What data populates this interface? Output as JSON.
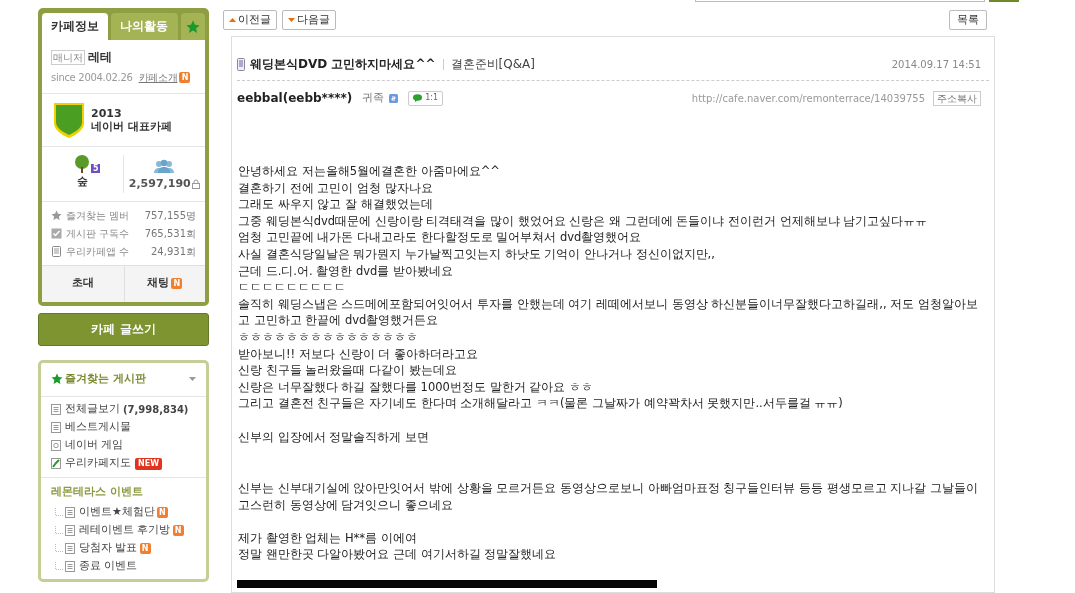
{
  "sidebar": {
    "tabs": [
      {
        "label": "카페정보",
        "selected": true
      },
      {
        "label": "나의활동",
        "selected": false
      }
    ],
    "manager": {
      "role": "매니저",
      "name": "레테"
    },
    "since": "since 2004.02.26",
    "intro_link": {
      "label": "카페소개",
      "badge": "N"
    },
    "award": {
      "year": "2013",
      "title": "네이버 대표카페"
    },
    "stats": {
      "level_badge": "5",
      "rank": "숲",
      "members": "2,597,190"
    },
    "counts": [
      {
        "kind": "star",
        "label": "즐겨찾는 멤버",
        "value": "757,155명"
      },
      {
        "kind": "check",
        "label": "게시판 구독수",
        "value": "765,531회"
      },
      {
        "kind": "phone",
        "label": "우리카페앱 수",
        "value": "24,931회"
      }
    ],
    "actions": [
      {
        "label": "초대"
      },
      {
        "label": "채팅",
        "badge": "N"
      }
    ],
    "write_button": "카페 글쓰기",
    "favorites_title": "즐겨찾는 게시판",
    "boards": [
      {
        "kind": "list",
        "label": "전체글보기",
        "count": "(7,998,834)"
      },
      {
        "kind": "list",
        "label": "베스트게시물"
      },
      {
        "kind": "game",
        "label": "네이버 게임"
      },
      {
        "kind": "map",
        "label": "우리카페지도",
        "badge": "NEW"
      }
    ],
    "menu_group": {
      "title": "레몬테라스 이벤트",
      "items": [
        {
          "label": "이벤트★체험단",
          "badge": "N"
        },
        {
          "label": "레테이벤트 후기방",
          "badge": "N"
        },
        {
          "label": "당첨자 발표",
          "badge": "N"
        },
        {
          "label": "종료 이벤트"
        }
      ]
    }
  },
  "nav": {
    "prev": "이전글",
    "next": "다음글",
    "list": "목록"
  },
  "post": {
    "title": "웨딩본식DVD 고민하지마세요^^",
    "category": "결혼준비[Q&A]",
    "date": "2014.09.17 14:51",
    "author": "eebbal(eebb****)",
    "grade": "귀족",
    "chat": "1:1",
    "url": "http://cafe.naver.com/remonterrace/14039755",
    "copy_button": "주소복사",
    "paragraphs": [
      [
        "안녕하세요 저는올해5월에결혼한 아줌마에요^^",
        "결혼하기 전에 고민이 엄청 많자나요",
        "그래도 싸우지 않고 잘 해결했었는데",
        "그중 웨딩본식dvd때문에 신랑이랑 티격태격을 많이 했었어요 신랑은 왜 그런데에 돈들이냐 전이런거 언제해보냐 남기고싶다ㅠㅠ",
        "엄청 고민끝에 내가돈 다내고라도 한다할정도로 밀어부쳐서 dvd촬영했어요",
        "사실 결혼식당일날은 뭐가뭔지 누가날찍고잇는지 하낫도 기억이 안나거나 정신이없지만,,",
        "근데 드.디.어. 촬영한 dvd를 받아봤네요",
        "ㄷㄷㄷㄷㄷㄷㄷㄷㄷ",
        "솔직히 웨딩스냅은 스드메에포함되어잇어서 투자를 안했는데 여기 레떼에서보니 동영상 하신분들이너무잘했다고하길래,, 저도 엄청알아보고 고민하고 한끝에 dvd촬영했거든요",
        "ㅎㅎㅎㅎㅎㅎㅎㅎㅎㅎㅎㅎㅎㅎㅎ",
        "받아보니!! 저보다 신랑이 더 좋아하더라고요",
        "신랑 친구들 놀러왔을때 다같이 봤는데요",
        "신랑은 너무잘했다 하길 잘했다를 1000번정도 말한거 같아요 ㅎㅎ",
        "그리고 결혼전 친구들은 자기네도 한다며 소개해달라고 ㅋㅋ(물론 그날짜가 예약꽉차서 못했지만..서두를걸 ㅠㅠ)"
      ],
      [
        "신부의 입장에서 정말솔직하게 보면"
      ],
      [
        "신부는 신부대기실에 앉아만잇어서 밖에 상황을 모르거든요 동영상으로보니 아빠엄마표정 칭구들인터뷰 등등 평생모르고 지나갈 그날들이 고스런히 동영상에 담겨잇으니 좋으네요"
      ],
      [
        "제가 촬영한 업체는 H**름 이에여",
        "정말 왠만한곳 다알아봤어요 근데 여기서하길 정말잘했네요"
      ]
    ]
  }
}
